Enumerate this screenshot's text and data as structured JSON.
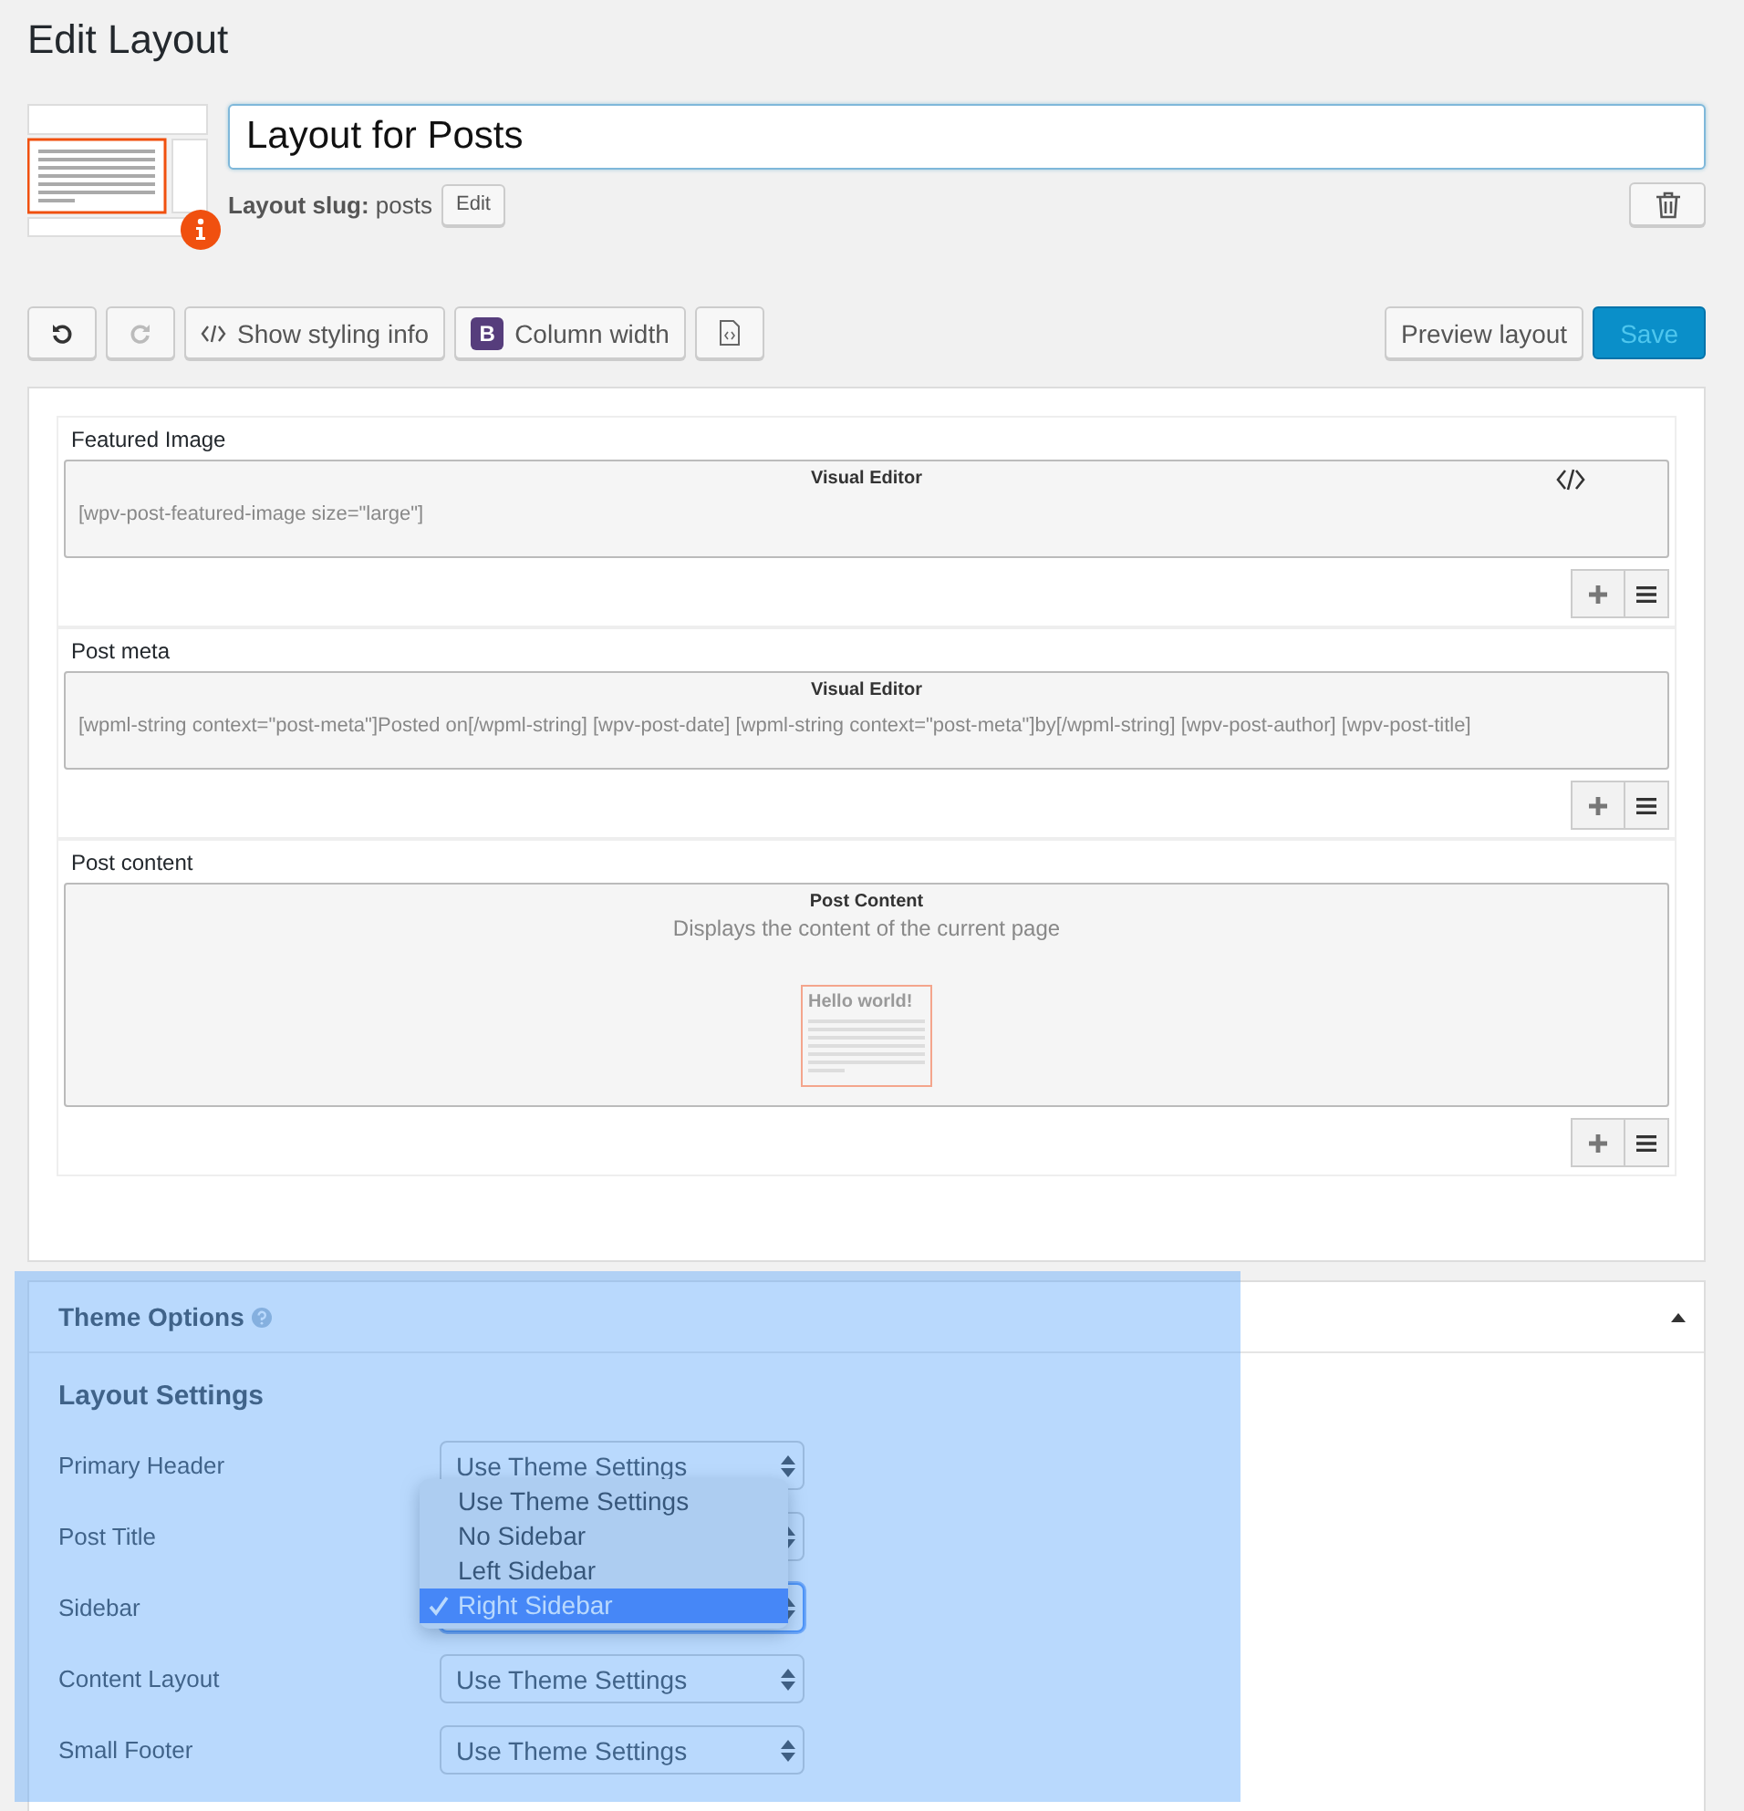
{
  "page_title": "Edit Layout",
  "layout_name": "Layout for Posts",
  "slug": {
    "label": "Layout slug:",
    "value": "posts",
    "button": "Edit"
  },
  "toolbar": [
    {
      "kind": "undo",
      "disabled": false
    },
    {
      "kind": "redo",
      "disabled": true
    },
    {
      "kind": "styling",
      "label": "Show styling info"
    },
    {
      "kind": "bootstrap",
      "badge": "B",
      "label": "Column width"
    },
    {
      "kind": "file"
    }
  ],
  "preview_button": "Preview layout",
  "save_button": "Save",
  "cells": [
    {
      "title": "Featured Image",
      "kind": "visual",
      "heading": "Visual Editor",
      "code_icon": true,
      "content": "[wpv-post-featured-image size=\"large\"]"
    },
    {
      "title": "Post meta",
      "kind": "visual",
      "heading": "Visual Editor",
      "code_icon": false,
      "content": "[wpml-string context=\"post-meta\"]Posted on[/wpml-string] [wpv-post-date] [wpml-string context=\"post-meta\"]by[/wpml-string] [wpv-post-author] [wpv-post-title]"
    },
    {
      "title": "Post content",
      "kind": "post_content",
      "heading": "Post Content",
      "code_icon": false,
      "content": "Displays the content of the current page",
      "preview_title": "Hello world!"
    }
  ],
  "theme_options": {
    "title": "Theme Options",
    "expanded": true,
    "section": "Layout Settings",
    "settings": [
      {
        "label": "Primary Header",
        "value": "Use Theme Settings",
        "open": false
      },
      {
        "label": "Post Title",
        "open": false
      },
      {
        "label": "Sidebar",
        "open": true,
        "options": [
          {
            "label": "Use Theme Settings",
            "selected": false
          },
          {
            "label": "No Sidebar",
            "selected": false
          },
          {
            "label": "Left Sidebar",
            "selected": false
          },
          {
            "label": "Right Sidebar",
            "selected": true
          }
        ]
      },
      {
        "label": "Content Layout",
        "value": "Use Theme Settings",
        "open": false
      },
      {
        "label": "Small Footer",
        "value": "Use Theme Settings",
        "open": false
      }
    ]
  }
}
